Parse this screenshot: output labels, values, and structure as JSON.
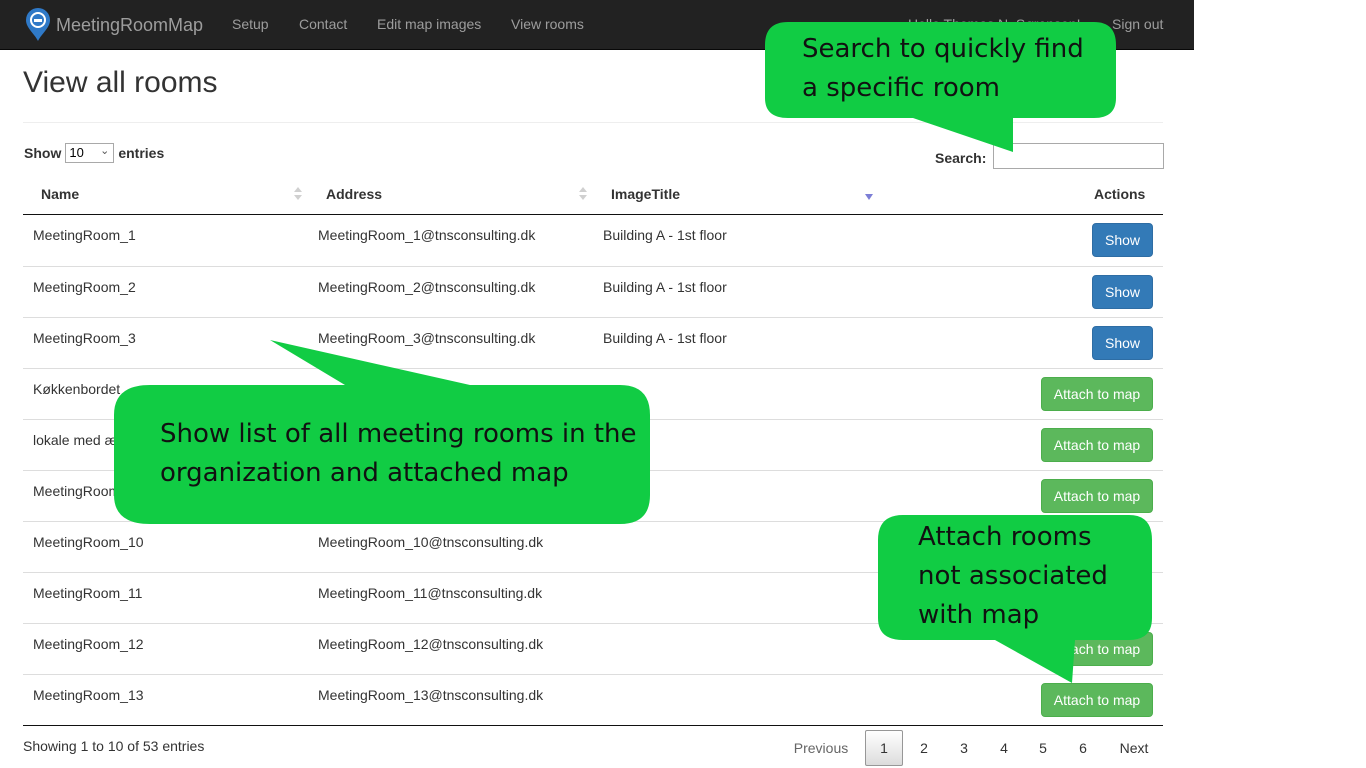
{
  "navbar": {
    "brand": "MeetingRoomMap",
    "links": [
      "Setup",
      "Contact",
      "Edit map images",
      "View rooms"
    ],
    "hello": "Hello Thomas N. Sørensen!",
    "signout": "Sign out",
    "colors": {
      "background": "#222222",
      "text": "#9d9d9d"
    }
  },
  "page": {
    "title": "View all rooms"
  },
  "length": {
    "show": "Show",
    "value": "10",
    "entries": "entries"
  },
  "search": {
    "label": "Search:",
    "value": ""
  },
  "table": {
    "columns": [
      "Name",
      "Address",
      "ImageTitle",
      "Actions"
    ],
    "rows": [
      {
        "name": "MeetingRoom_1",
        "address": "MeetingRoom_1@tnsconsulting.dk",
        "image": "Building A - 1st floor",
        "action": "Show"
      },
      {
        "name": "MeetingRoom_2",
        "address": "MeetingRoom_2@tnsconsulting.dk",
        "image": "Building A - 1st floor",
        "action": "Show"
      },
      {
        "name": "MeetingRoom_3",
        "address": "MeetingRoom_3@tnsconsulting.dk",
        "image": "Building A - 1st floor",
        "action": "Show"
      },
      {
        "name": "Køkkenbordet",
        "address": "",
        "image": "",
        "action": "Attach to map"
      },
      {
        "name": "lokale med æ",
        "address": "",
        "image": "",
        "action": "Attach to map"
      },
      {
        "name": "MeetingRoom",
        "address": "",
        "image": "",
        "action": "Attach to map"
      },
      {
        "name": "MeetingRoom_10",
        "address": "MeetingRoom_10@tnsconsulting.dk",
        "image": "",
        "action": ""
      },
      {
        "name": "MeetingRoom_11",
        "address": "MeetingRoom_11@tnsconsulting.dk",
        "image": "",
        "action": ""
      },
      {
        "name": "MeetingRoom_12",
        "address": "MeetingRoom_12@tnsconsulting.dk",
        "image": "",
        "action": "Attach to map"
      },
      {
        "name": "MeetingRoom_13",
        "address": "MeetingRoom_13@tnsconsulting.dk",
        "image": "",
        "action": "Attach to map"
      }
    ],
    "colors": {
      "show": "#337ab7",
      "attach": "#5cb85c"
    }
  },
  "footer": {
    "info": "Showing 1 to 10 of 53 entries",
    "previous": "Previous",
    "pages": [
      "1",
      "2",
      "3",
      "4",
      "5",
      "6"
    ],
    "next": "Next",
    "current_page": "1"
  },
  "callouts": {
    "search": [
      "Search to quickly find",
      "a specific room"
    ],
    "show_list": [
      "Show list of all meeting rooms in the",
      "organization and attached map"
    ],
    "attach": [
      "Attach rooms",
      "not associated",
      "with map"
    ],
    "color": "#11cc44"
  }
}
